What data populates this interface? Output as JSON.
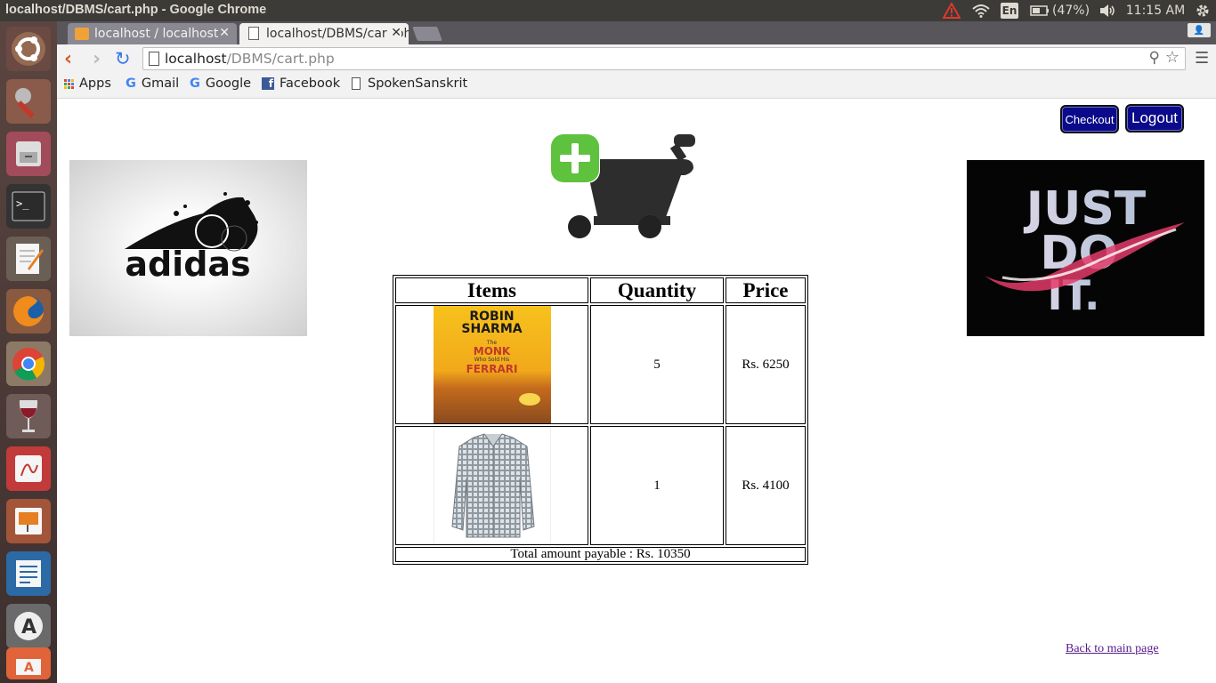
{
  "window": {
    "title": "localhost/DBMS/cart.php - Google Chrome",
    "keyboard": "En",
    "battery": "(47%)",
    "clock": "11:15 AM"
  },
  "tabs": [
    {
      "label": "localhost / localhost"
    },
    {
      "label": "localhost/DBMS/cart.php"
    }
  ],
  "address": {
    "host": "localhost",
    "path": "/DBMS/cart.php"
  },
  "bookmarks": [
    {
      "label": "Apps"
    },
    {
      "label": "Gmail"
    },
    {
      "label": "Google"
    },
    {
      "label": "Facebook"
    },
    {
      "label": "SpokenSanskrit"
    }
  ],
  "header": {
    "checkout_label": "Checkout",
    "logout_label": "Logout"
  },
  "cart_table": {
    "columns": [
      "Items",
      "Quantity",
      "Price"
    ],
    "rows": [
      {
        "item": "The Monk Who Sold His Ferrari book",
        "quantity": "5",
        "price": "Rs. 6250"
      },
      {
        "item": "checked shirt",
        "quantity": "1",
        "price": "Rs. 4100"
      }
    ],
    "total": "Total amount payable : Rs. 10350"
  },
  "book_cover": {
    "line1": "ROBIN",
    "line2": "SHARMA",
    "line3": "The",
    "line4": "MONK",
    "line5": "Who Sold His",
    "line6": "FERRARI"
  },
  "banners": {
    "left_logo": "adidas",
    "right_slogan_1": "JUST",
    "right_slogan_2": "DO",
    "right_slogan_3": "IT."
  },
  "back_link": "Back to main page",
  "colors": {
    "button_bg": "#0a0a8a",
    "link": "#551a8b"
  }
}
